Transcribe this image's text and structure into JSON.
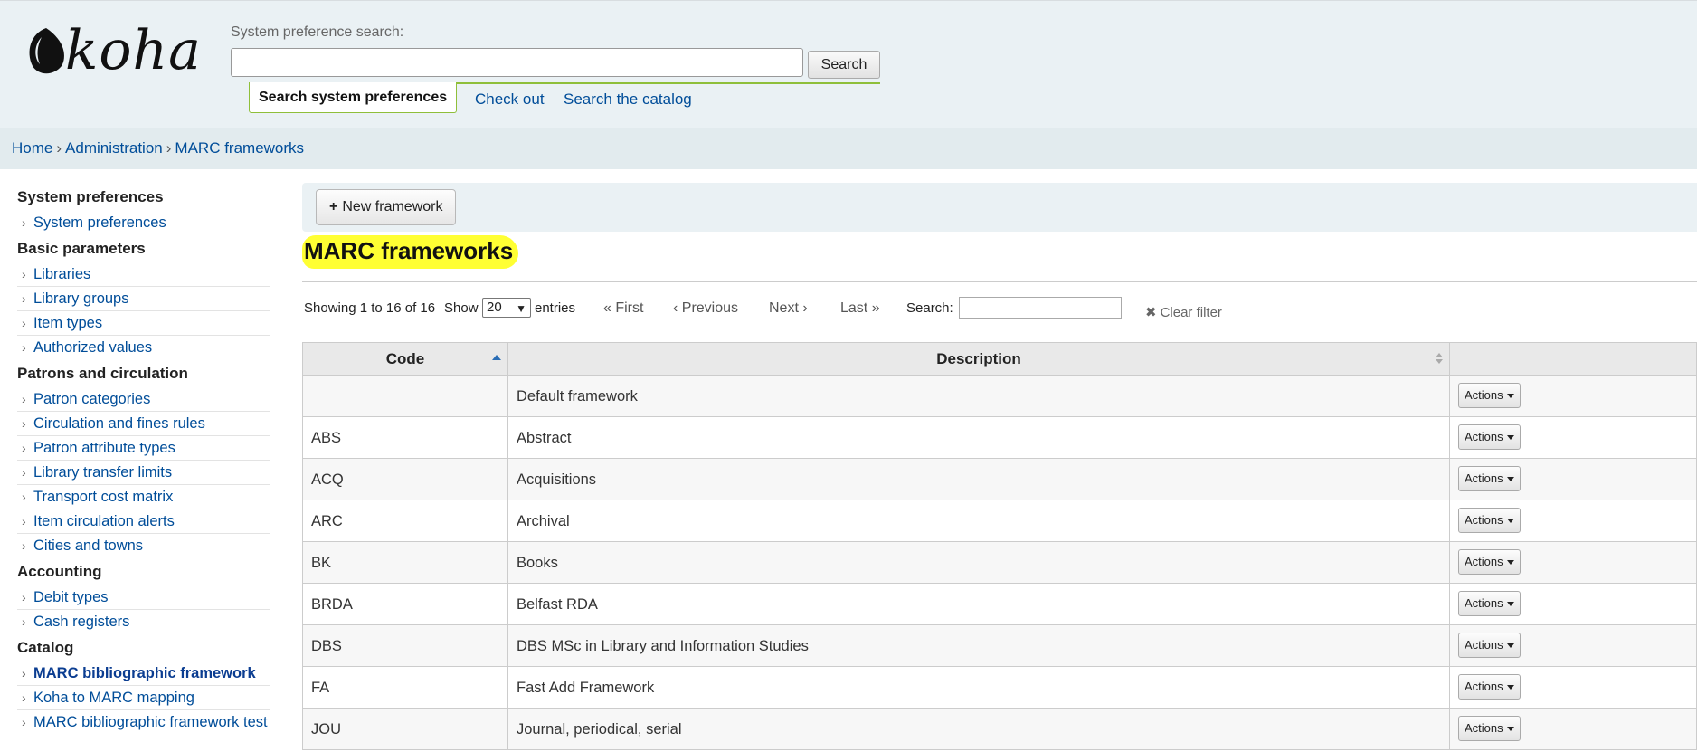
{
  "header": {
    "logo_text": "koha",
    "syspref_label": "System preference search:",
    "search_button": "Search",
    "tabs": [
      {
        "label": "Search system preferences",
        "active": true
      },
      {
        "label": "Check out",
        "active": false
      },
      {
        "label": "Search the catalog",
        "active": false
      }
    ]
  },
  "breadcrumb": [
    "Home",
    "Administration",
    "MARC frameworks"
  ],
  "breadcrumb_sep": "›",
  "sidebar": [
    {
      "heading": "System preferences",
      "items": [
        "System preferences"
      ]
    },
    {
      "heading": "Basic parameters",
      "items": [
        "Libraries",
        "Library groups",
        "Item types",
        "Authorized values"
      ]
    },
    {
      "heading": "Patrons and circulation",
      "items": [
        "Patron categories",
        "Circulation and fines rules",
        "Patron attribute types",
        "Library transfer limits",
        "Transport cost matrix",
        "Item circulation alerts",
        "Cities and towns"
      ]
    },
    {
      "heading": "Accounting",
      "items": [
        "Debit types",
        "Cash registers"
      ]
    },
    {
      "heading": "Catalog",
      "items": [
        "MARC bibliographic framework",
        "Koha to MARC mapping",
        "MARC bibliographic framework test"
      ]
    }
  ],
  "sidebar_active": "MARC bibliographic framework",
  "toolbar": {
    "new_framework": "New framework"
  },
  "page_title": "MARC frameworks",
  "datatable": {
    "info": "Showing 1 to 16 of 16",
    "show_label": "Show",
    "page_length": "20",
    "entries_label": "entries",
    "first": "« First",
    "previous": "‹ Previous",
    "next": "Next ›",
    "last": "Last »",
    "search_label": "Search:",
    "clear_filter": "Clear filter"
  },
  "table": {
    "columns": [
      "Code",
      "Description",
      ""
    ],
    "action_label": "Actions",
    "rows": [
      {
        "code": "",
        "description": "Default framework"
      },
      {
        "code": "ABS",
        "description": "Abstract"
      },
      {
        "code": "ACQ",
        "description": "Acquisitions"
      },
      {
        "code": "ARC",
        "description": "Archival"
      },
      {
        "code": "BK",
        "description": "Books"
      },
      {
        "code": "BRDA",
        "description": "Belfast RDA"
      },
      {
        "code": "DBS",
        "description": "DBS MSc in Library and Information Studies"
      },
      {
        "code": "FA",
        "description": "Fast Add Framework"
      },
      {
        "code": "JOU",
        "description": "Journal, periodical, serial"
      }
    ]
  },
  "colors": {
    "accent_green": "#8fbf3a",
    "link_blue": "#004d99",
    "highlight": "#ffff33"
  }
}
